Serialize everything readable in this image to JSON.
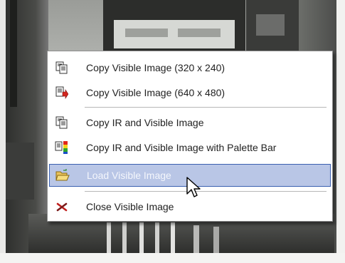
{
  "context_menu": {
    "items": [
      {
        "label": "Copy Visible Image (320 x 240)",
        "icon": "copy-icon"
      },
      {
        "label": "Copy Visible Image (640 x 480)",
        "icon": "copy-large-icon"
      },
      {
        "label": "Copy IR and Visible Image",
        "icon": "copy-icon"
      },
      {
        "label": "Copy IR and Visible Image with Palette Bar",
        "icon": "palette-bar-icon"
      },
      {
        "label": "Load Visible Image",
        "icon": "open-folder-icon"
      },
      {
        "label": "Close Visible Image",
        "icon": "close-x-icon"
      }
    ],
    "highlighted_item": "Load Visible Image"
  },
  "colors": {
    "highlight_bg": "#b9c6e6",
    "highlight_border": "#3a5fb0",
    "menu_bg": "#ffffff",
    "close_icon": "#c0201e"
  }
}
